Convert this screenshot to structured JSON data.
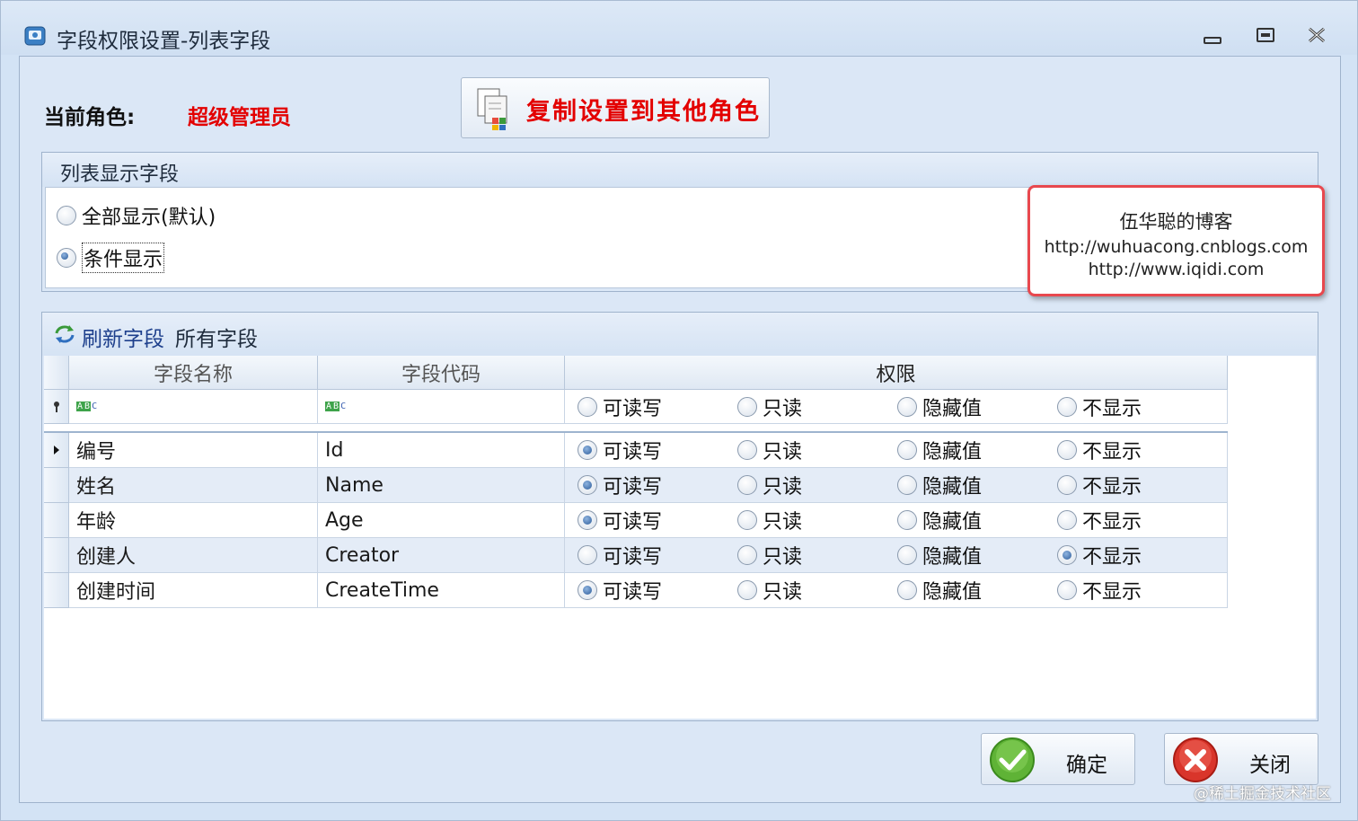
{
  "window": {
    "title": "字段权限设置-列表字段"
  },
  "role": {
    "label": "当前角色:",
    "value": "超级管理员"
  },
  "copy_button": {
    "label": "复制设置到其他角色"
  },
  "list_display_group": {
    "title": "列表显示字段",
    "options": [
      {
        "label": "全部显示(默认)",
        "selected": false
      },
      {
        "label": "条件显示",
        "selected": true
      }
    ]
  },
  "blog_note": {
    "line1": "伍华聪的博客",
    "line2": "http://wuhuacong.cnblogs.com",
    "line3": "http://www.iqidi.com"
  },
  "fields_group": {
    "refresh_label": "刷新字段",
    "all_fields_label": "所有字段",
    "columns": {
      "name": "字段名称",
      "code": "字段代码",
      "permission": "权限"
    },
    "permission_options": [
      "可读写",
      "只读",
      "隐藏值",
      "不显示"
    ],
    "filter_row": {
      "selected": null
    },
    "rows": [
      {
        "name": "编号",
        "code": "Id",
        "selected": 0
      },
      {
        "name": "姓名",
        "code": "Name",
        "selected": 0
      },
      {
        "name": "年龄",
        "code": "Age",
        "selected": 0
      },
      {
        "name": "创建人",
        "code": "Creator",
        "selected": 3
      },
      {
        "name": "创建时间",
        "code": "CreateTime",
        "selected": 0
      }
    ]
  },
  "buttons": {
    "ok": "确定",
    "close": "关闭"
  },
  "watermark": "@稀土掘金技术社区",
  "colors": {
    "accent_red": "#e30000",
    "window_bg": "#d3e3f5",
    "link_blue": "#1d3f8c"
  }
}
